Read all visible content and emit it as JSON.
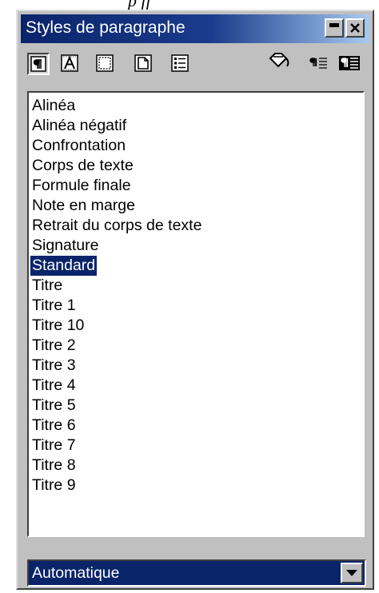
{
  "background": {
    "top_fragment": "p  ff"
  },
  "panel": {
    "title": "Styles de paragraphe",
    "toolbar": {
      "left_tools": [
        {
          "icon": "paragraph-styles-icon",
          "pressed": true
        },
        {
          "icon": "character-styles-icon",
          "pressed": false
        },
        {
          "icon": "frame-styles-icon",
          "pressed": false
        },
        {
          "icon": "page-styles-icon",
          "pressed": false
        },
        {
          "icon": "numbering-styles-icon",
          "pressed": false
        }
      ],
      "right_tools": [
        {
          "icon": "fill-format-mode-icon"
        },
        {
          "icon": "new-style-from-selection-icon"
        },
        {
          "icon": "update-style-icon"
        }
      ]
    },
    "styles_list": [
      "Alinéa",
      "Alinéa négatif",
      "Confrontation",
      "Corps de texte",
      "Formule finale",
      "Note en marge",
      "Retrait du corps de texte",
      "Signature",
      "Standard",
      "Titre",
      "Titre 1",
      "Titre 10",
      "Titre 2",
      "Titre 3",
      "Titre 4",
      "Titre 5",
      "Titre 6",
      "Titre 7",
      "Titre 8",
      "Titre 9"
    ],
    "selected_style": "Standard",
    "filter_select": {
      "value": "Automatique"
    }
  },
  "colors": {
    "titlebar": "#0a246a",
    "selection": "#0a246a",
    "face": "#c0c0c0"
  }
}
